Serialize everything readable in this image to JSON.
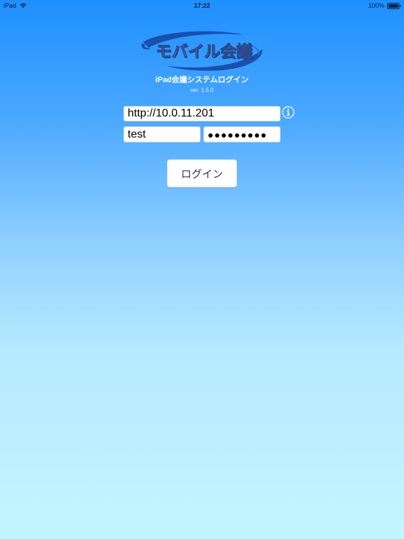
{
  "status_bar": {
    "device": "iPad",
    "time": "17:22",
    "battery": "100%"
  },
  "logo": {
    "text": "モバイル会議"
  },
  "login": {
    "title": "iPad会議システムログイン",
    "version": "ver. 1.5.0",
    "url_value": "http://10.0.11.201",
    "username_value": "test",
    "password_value": "●●●●●●●●●",
    "button_label": "ログイン"
  },
  "colors": {
    "background_top": "#1e8fff",
    "background_bottom": "#c2f6ff",
    "logo_swoosh": "#1b4fae",
    "button_text": "#2a3a55"
  }
}
